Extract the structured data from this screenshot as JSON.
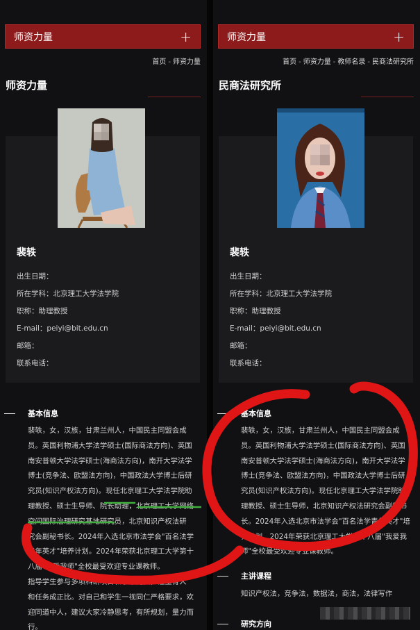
{
  "left": {
    "menu_label": "师资力量",
    "menu_plus": "+",
    "breadcrumb": [
      "首页",
      "师资力量"
    ],
    "page_title": "师资力量",
    "name": "裴轶",
    "info": [
      {
        "label": "出生日期：",
        "value": ""
      },
      {
        "label": "所在学科：",
        "value": "北京理工大学法学院"
      },
      {
        "label": "职称：",
        "value": "助理教授"
      },
      {
        "label": "E-mail：",
        "value": "peiyi@bit.edu.cn"
      },
      {
        "label": "邮箱：",
        "value": ""
      },
      {
        "label": "联系电话：",
        "value": ""
      }
    ],
    "section_basic": "基本信息",
    "bio_lines": [
      "裴轶，女，汉族，甘肃兰州人，中国民主同盟会成",
      "员。英国利物浦大学法学硕士(国际商法方向)、英国",
      "南安普顿大学法学硕士(海商法方向)，南开大学法学",
      "博士(竞争法、欧盟法方向)，中国政法大学博士后研",
      "究员(知识产权法方向)。现任北京理工大学法学院助",
      "理教授、硕士生导师、院长助理，北京理工大学网络",
      "空间国际治理研究基地研究员，北京知识产权法研",
      "究会副秘书长。2024年入选北京市法学会\"百名法学",
      "青年英才\"培养计划。2024年荣获北京理工大学第十",
      "八届\"我爱我师\"全校最受欢迎专业课教师。",
      "指导学生参与多项科研项目和学术竞赛，注重育人",
      "和任务成正比。对自己和学生一视同仁严格要求，欢",
      "迎同道中人，建议大家冷静思考，有所规划，量力而",
      "行。"
    ]
  },
  "right": {
    "menu_label": "师资力量",
    "menu_plus": "+",
    "breadcrumb": [
      "首页",
      "师资力量",
      "教师名录",
      "民商法研究所"
    ],
    "page_title": "民商法研究所",
    "name": "裴轶",
    "info": [
      {
        "label": "出生日期：",
        "value": ""
      },
      {
        "label": "所在学科：",
        "value": "北京理工大学法学院"
      },
      {
        "label": "职称：",
        "value": "助理教授"
      },
      {
        "label": "E-mail：",
        "value": "peiyi@bit.edu.cn"
      },
      {
        "label": "邮箱：",
        "value": ""
      },
      {
        "label": "联系电话：",
        "value": ""
      }
    ],
    "section_basic": "基本信息",
    "bio_lines": [
      "裴轶，女，汉族，甘肃兰州人，中国民主同盟会成",
      "员。英国利物浦大学法学硕士(国际商法方向)、英国",
      "南安普顿大学法学硕士(海商法方向)，南开大学法学",
      "博士(竞争法、欧盟法方向)，中国政法大学博士后研",
      "究员(知识产权法方向)。现任北京理工大学法学院助",
      "理教授、硕士生导师，北京知识产权法研究会副秘书",
      "长。2024年入选北京市法学会\"百名法学青年英才\"培",
      "养计划。2024年荣获北京理工大学第十八届\"我爱我",
      "师\"全校最受欢迎专业课教师。"
    ],
    "section_courses": "主讲课程",
    "courses": "知识产权法，竞争法，数据法，商法，法律写作",
    "section_research": "研究方向"
  },
  "colors": {
    "accent": "#8e1b1b",
    "scribble": "#e01616"
  }
}
